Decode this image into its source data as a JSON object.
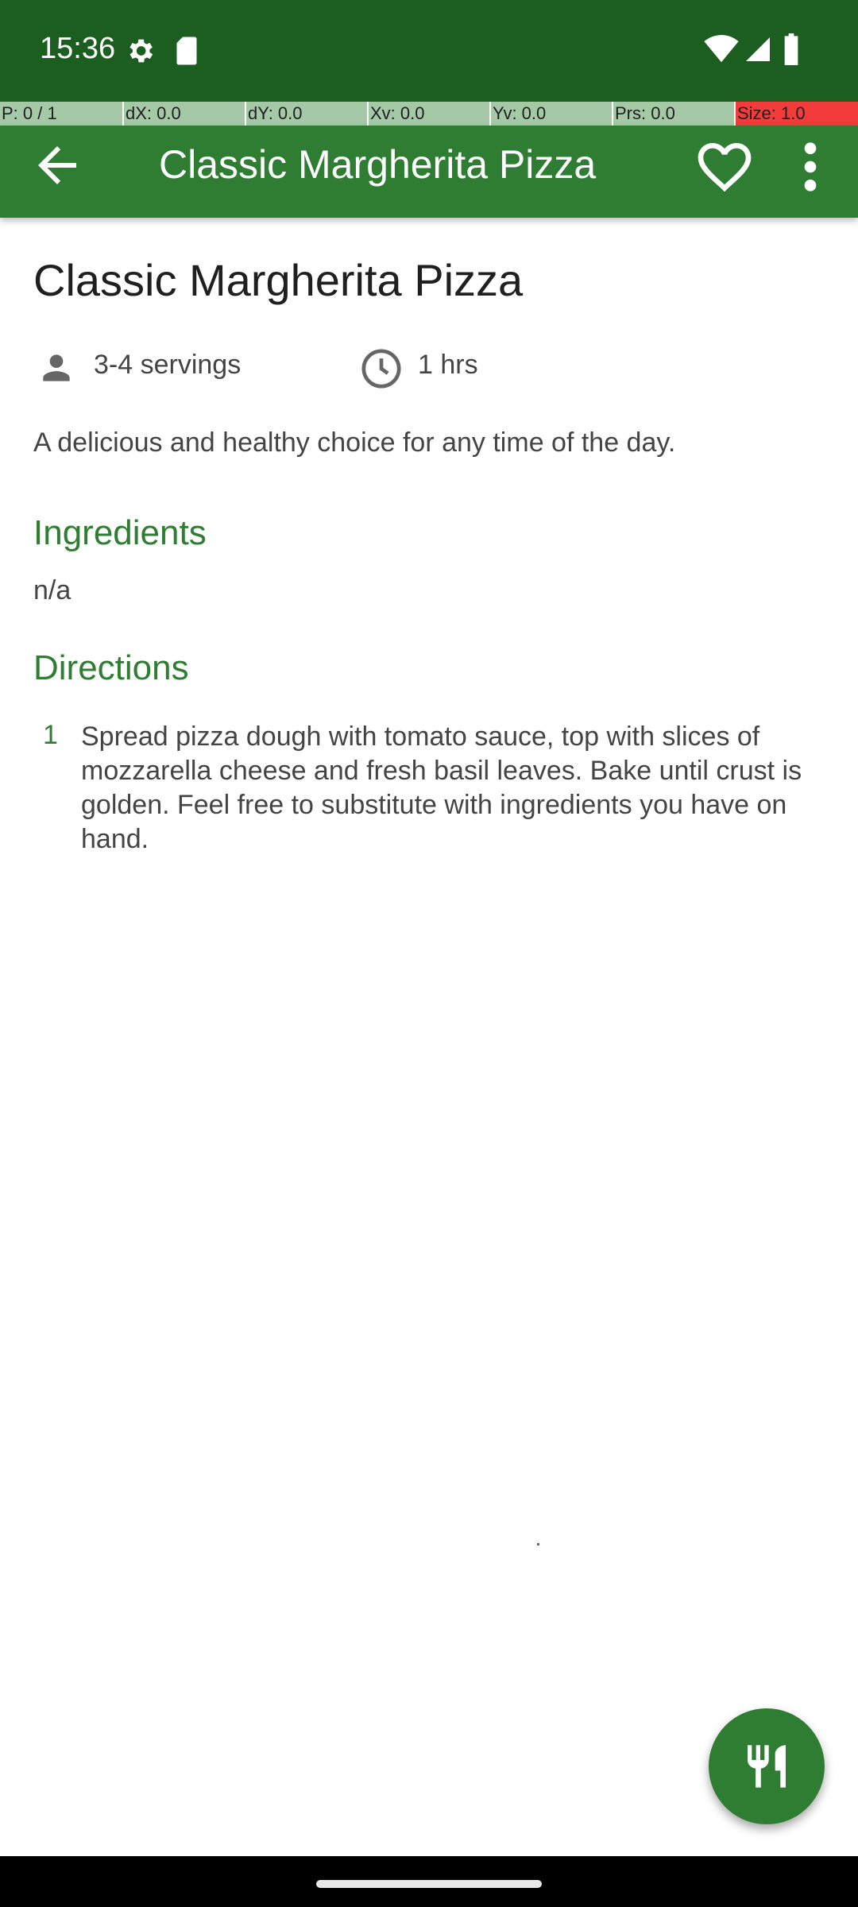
{
  "status": {
    "time": "15:36",
    "icons": [
      "gear-icon",
      "sd-card-icon",
      "wifi-icon",
      "signal-icon",
      "battery-icon"
    ]
  },
  "debug": {
    "cells": [
      "P: 0 / 1",
      "dX: 0.0",
      "dY: 0.0",
      "Xv: 0.0",
      "Yv: 0.0",
      "Prs: 0.0",
      "Size: 1.0"
    ]
  },
  "appbar": {
    "title": "Classic Margherita Pizza",
    "icons": [
      "back-arrow-icon",
      "heart-outline-icon",
      "more-vert-icon"
    ]
  },
  "recipe": {
    "title": "Classic Margherita Pizza",
    "servings": "3-4 servings",
    "time": "1 hrs",
    "description": "A delicious and healthy choice for any time of the day.",
    "ingredients_heading": "Ingredients",
    "ingredients": "n/a",
    "directions_heading": "Directions",
    "steps": [
      {
        "number": "1",
        "text": "Spread pizza dough with tomato sauce, top with slices of mozzarella cheese and fresh basil leaves. Bake until crust is golden. Feel free to substitute with ingredients you have on hand."
      }
    ]
  },
  "fab": {
    "icon": "utensils-icon"
  },
  "colors": {
    "status_bar": "#1b5e20",
    "app_bar": "#2e7d32",
    "accent": "#2e7d32",
    "debug_cell": "#a5c8a7",
    "debug_alert": "#f23b3b"
  }
}
